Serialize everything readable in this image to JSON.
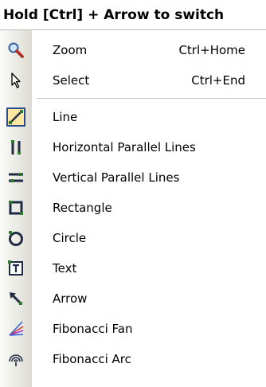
{
  "header": {
    "title": "Hold [Ctrl] + Arrow to switch"
  },
  "menu": {
    "nav_items": [
      {
        "label": "Zoom",
        "shortcut": "Ctrl+Home",
        "icon": "zoom-magnifier-icon"
      },
      {
        "label": "Select",
        "shortcut": "Ctrl+End",
        "icon": "cursor-arrow-icon"
      }
    ],
    "tool_items": [
      {
        "label": "Line",
        "icon": "line-icon",
        "selected": true
      },
      {
        "label": "Horizontal Parallel Lines",
        "icon": "horizontal-parallel-lines-icon"
      },
      {
        "label": "Vertical Parallel Lines",
        "icon": "vertical-parallel-lines-icon"
      },
      {
        "label": "Rectangle",
        "icon": "rectangle-icon"
      },
      {
        "label": "Circle",
        "icon": "circle-icon"
      },
      {
        "label": "Text",
        "icon": "text-icon"
      },
      {
        "label": "Arrow",
        "icon": "arrow-icon"
      },
      {
        "label": "Fibonacci Fan",
        "icon": "fibonacci-fan-icon"
      },
      {
        "label": "Fibonacci Arc",
        "icon": "fibonacci-arc-icon"
      }
    ]
  },
  "colors": {
    "gutter_start": "#fbfbf9",
    "gutter_end": "#dcdcd3",
    "selected_bg": "#ffe7a2",
    "selected_border": "#2b4a8f",
    "icon_navy": "#1f2a44"
  }
}
